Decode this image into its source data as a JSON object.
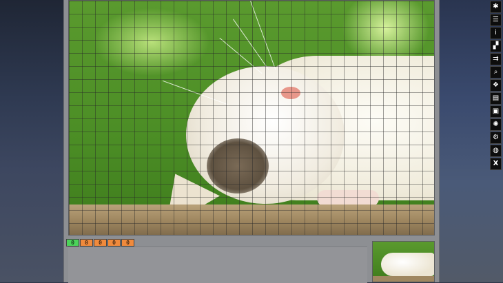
{
  "counters": [
    {
      "value": "0",
      "color": "#4cd35a"
    },
    {
      "value": "0",
      "color": "#f08a3c"
    },
    {
      "value": "0",
      "color": "#f08a3c"
    },
    {
      "value": "0",
      "color": "#f08a3c"
    },
    {
      "value": "0",
      "color": "#f08a3c"
    }
  ],
  "toolbar": {
    "items": [
      {
        "name": "scatter-icon",
        "glyph": "✱"
      },
      {
        "name": "menu-list-icon",
        "glyph": "☰"
      },
      {
        "name": "info-icon",
        "glyph": "i"
      },
      {
        "name": "edge-pieces-icon",
        "glyph": "▞"
      },
      {
        "name": "sort-pieces-icon",
        "glyph": "⇉"
      },
      {
        "name": "search-icon",
        "glyph": "⌕"
      },
      {
        "name": "puzzle-piece-icon",
        "glyph": "❖"
      },
      {
        "name": "save-icon",
        "glyph": "▤"
      },
      {
        "name": "preview-icon",
        "glyph": "▣"
      },
      {
        "name": "gear-settings-icon",
        "glyph": "✺"
      },
      {
        "name": "cog-icon",
        "glyph": "⚙"
      },
      {
        "name": "globe-icon",
        "glyph": "◍"
      },
      {
        "name": "close-icon",
        "glyph": "X"
      }
    ]
  },
  "colors": {
    "frame": "#8d8f93",
    "toolbar_bg": "#0d0d0d",
    "counter_green": "#4cd35a",
    "counter_orange": "#f08a3c"
  }
}
